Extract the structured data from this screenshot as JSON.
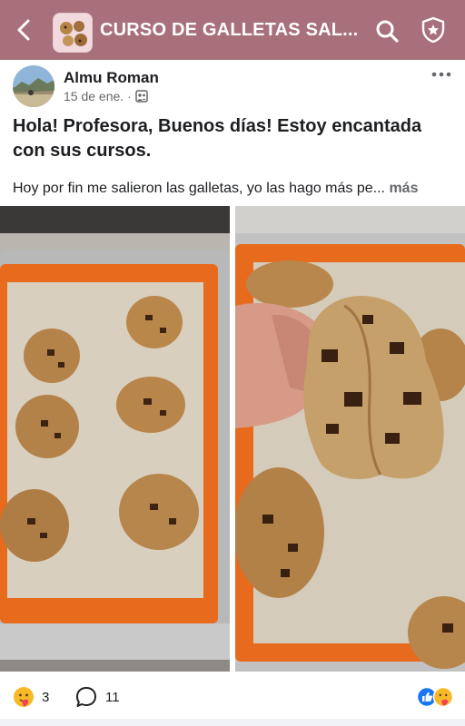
{
  "header": {
    "title": "CURSO DE GALLETAS SAL...",
    "background": "#a8707a",
    "icons": [
      "chevron-left-icon",
      "search-icon",
      "shield-star-icon"
    ]
  },
  "post": {
    "author": "Almu Roman",
    "date": "15 de ene.",
    "separator": "·",
    "title": "Hola! Profesora, Buenos días! Estoy encantada con sus cursos.",
    "body": "Hoy por fin me salieron las galletas, yo las hago más pe...",
    "more_label": "más"
  },
  "photos": [
    {
      "subject": "cookies-on-baking-mat"
    },
    {
      "subject": "hand-holding-broken-cookie"
    }
  ],
  "reactions": {
    "count": "3",
    "comments": "11"
  }
}
